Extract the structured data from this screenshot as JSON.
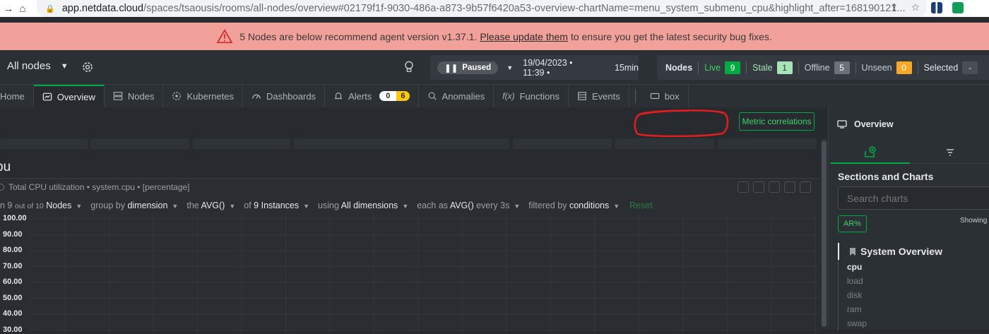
{
  "browser": {
    "url_host": "app.netdata.cloud",
    "url_path": "/spaces/tsaousis/rooms/all-nodes/overview#02179f1f-9030-486a-a873-9b57f6420a53-overview-chartName=menu_system_submenu_cpu&highlight_after=168190121..."
  },
  "banner": {
    "text_before": "5 Nodes are below recommend agent version v1.37.1.",
    "link": "Please update them",
    "text_after": "to ensure you get the latest security bug fixes."
  },
  "topbar": {
    "room": "All nodes",
    "paused": "Paused",
    "datetime": "19/04/2023 • 11:39 •",
    "duration": "15min",
    "nodes_label": "Nodes",
    "live_label": "Live",
    "live_count": "9",
    "stale_label": "Stale",
    "stale_count": "1",
    "offline_label": "Offline",
    "offline_count": "5",
    "unseen_label": "Unseen",
    "unseen_count": "0",
    "selected_label": "Selected",
    "selected_count": "-"
  },
  "tabs": {
    "home": "Home",
    "overview": "Overview",
    "nodes": "Nodes",
    "kubernetes": "Kubernetes",
    "dashboards": "Dashboards",
    "alerts": "Alerts",
    "alerts_critical": "0",
    "alerts_warning": "6",
    "anomalies": "Anomalies",
    "functions": "Functions",
    "events": "Events",
    "box": "box"
  },
  "main": {
    "metric_correlations": "Metric correlations",
    "section_title": "pu",
    "chart_title": "Total CPU utilization • system.cpu • [percentage]",
    "filters": {
      "nodes_prefix": "n 9",
      "nodes_small": "out of 10",
      "nodes_label": "Nodes",
      "group_by": "group by",
      "group_by_value": "dimension",
      "the": "the",
      "the_value": "AVG()",
      "of": "of",
      "of_value": "9 Instances",
      "using": "using",
      "using_value": "All dimensions",
      "each_as": "each as",
      "each_as_value": "AVG()",
      "every": "every 3s",
      "filtered_by": "filtered by",
      "filtered_by_value": "conditions",
      "reset": "Reset"
    },
    "y_ticks": [
      "100.00",
      "90.00",
      "80.00",
      "70.00",
      "60.00",
      "50.00",
      "40.00",
      "30.00"
    ]
  },
  "sidebar": {
    "title": "Overview",
    "heading": "Sections and Charts",
    "search_placeholder": "Search charts",
    "ar_button": "AR%",
    "showing": "Showing",
    "section": "System Overview",
    "items": [
      "cpu",
      "load",
      "disk",
      "ram",
      "swap"
    ]
  },
  "colors": {
    "accent": "#00ab44",
    "banner": "#f2a19a",
    "background": "#272b30",
    "annotation": "#e11d1d"
  }
}
